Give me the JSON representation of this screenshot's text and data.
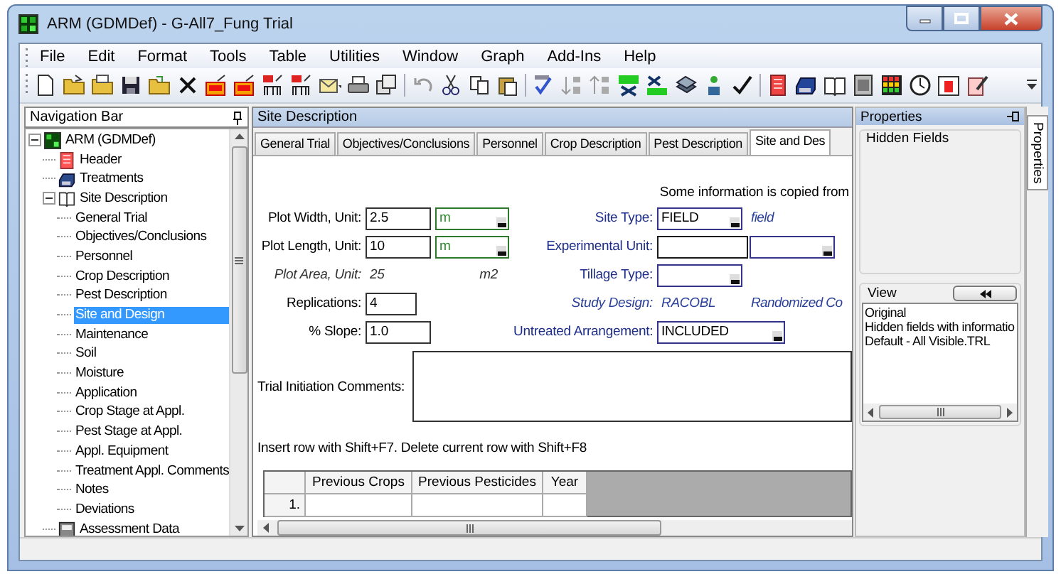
{
  "window": {
    "title": "ARM (GDMDef) - G-All7_Fung Trial"
  },
  "menu": [
    "File",
    "Edit",
    "Format",
    "Tools",
    "Table",
    "Utilities",
    "Window",
    "Graph",
    "Add-Ins",
    "Help"
  ],
  "navigation": {
    "title": "Navigation Bar",
    "tree": [
      {
        "label": "ARM (GDMDef)",
        "kind": "root",
        "expanded": true,
        "selected": false,
        "children": [
          {
            "label": "Header",
            "kind": "header",
            "selected": false
          },
          {
            "label": "Treatments",
            "kind": "treatments",
            "selected": false
          },
          {
            "label": "Site Description",
            "kind": "book",
            "expanded": true,
            "selected": false,
            "children": [
              {
                "label": "General Trial",
                "kind": "page",
                "selected": false
              },
              {
                "label": "Objectives/Conclusions",
                "kind": "page",
                "selected": false
              },
              {
                "label": "Personnel",
                "kind": "page",
                "selected": false
              },
              {
                "label": "Crop Description",
                "kind": "page",
                "selected": false
              },
              {
                "label": "Pest Description",
                "kind": "page",
                "selected": false
              },
              {
                "label": "Site and Design",
                "kind": "page",
                "selected": true
              },
              {
                "label": "Maintenance",
                "kind": "page",
                "selected": false
              },
              {
                "label": "Soil",
                "kind": "page",
                "selected": false
              },
              {
                "label": "Moisture",
                "kind": "page",
                "selected": false
              },
              {
                "label": "Application",
                "kind": "page",
                "selected": false
              },
              {
                "label": "Crop Stage at Appl.",
                "kind": "page",
                "selected": false
              },
              {
                "label": "Pest Stage at Appl.",
                "kind": "page",
                "selected": false
              },
              {
                "label": "Appl. Equipment",
                "kind": "page",
                "selected": false
              },
              {
                "label": "Treatment Appl. Comments",
                "kind": "page",
                "selected": false
              },
              {
                "label": "Notes",
                "kind": "page",
                "selected": false
              },
              {
                "label": "Deviations",
                "kind": "page",
                "selected": false
              }
            ]
          },
          {
            "label": "Assessment Data",
            "kind": "data",
            "selected": false
          }
        ]
      }
    ]
  },
  "document": {
    "title": "Site Description",
    "tabs": [
      {
        "label": "General Trial",
        "selected": false
      },
      {
        "label": "Objectives/Conclusions",
        "selected": false
      },
      {
        "label": "Personnel",
        "selected": false
      },
      {
        "label": "Crop Description",
        "selected": false
      },
      {
        "label": "Pest Description",
        "selected": false
      },
      {
        "label": "Site and Des",
        "selected": true
      }
    ],
    "note": "Some information is copied from",
    "rows": [
      {
        "left": {
          "kind": "input_unit",
          "label": "Plot Width, Unit:",
          "value": "2.5",
          "unit": "m"
        },
        "right": {
          "kind": "select",
          "label": "Site Type:",
          "value": "FIELD",
          "note": "field"
        }
      },
      {
        "left": {
          "kind": "input_unit",
          "label": "Plot Length, Unit:",
          "value": "10",
          "unit": "m"
        },
        "right": {
          "kind": "input_select",
          "label": "Experimental Unit:"
        }
      },
      {
        "left": {
          "kind": "computed",
          "label": "Plot Area, Unit:",
          "value": "25",
          "unit": "m2"
        },
        "right": {
          "kind": "select",
          "label": "Tillage Type:"
        }
      },
      {
        "left": {
          "kind": "short_input",
          "label": "Replications:",
          "value": "4"
        },
        "right": {
          "kind": "computed",
          "label": "Study Design:",
          "value": "RACOBL",
          "note": "Randomized Co"
        }
      },
      {
        "left": {
          "kind": "input",
          "label": "% Slope:",
          "value": "1.0"
        },
        "right": {
          "kind": "wide_select",
          "label": "Untreated Arrangement:",
          "value": "INCLUDED"
        }
      }
    ],
    "comments": {
      "label": "Trial Initiation Comments:"
    },
    "hint": "Insert row with Shift+F7. Delete current row with Shift+F8",
    "grid": {
      "columns": [
        "Previous Crops",
        "Previous Pesticides",
        "Year"
      ],
      "rows": [
        {
          "number": "1."
        }
      ]
    }
  },
  "properties": {
    "title": "Properties",
    "hidden_fields": "Hidden Fields",
    "view": "View",
    "views": [
      "Original",
      "Hidden fields with informatio",
      "Default - All Visible.TRL"
    ]
  },
  "side_tab": "Properties"
}
